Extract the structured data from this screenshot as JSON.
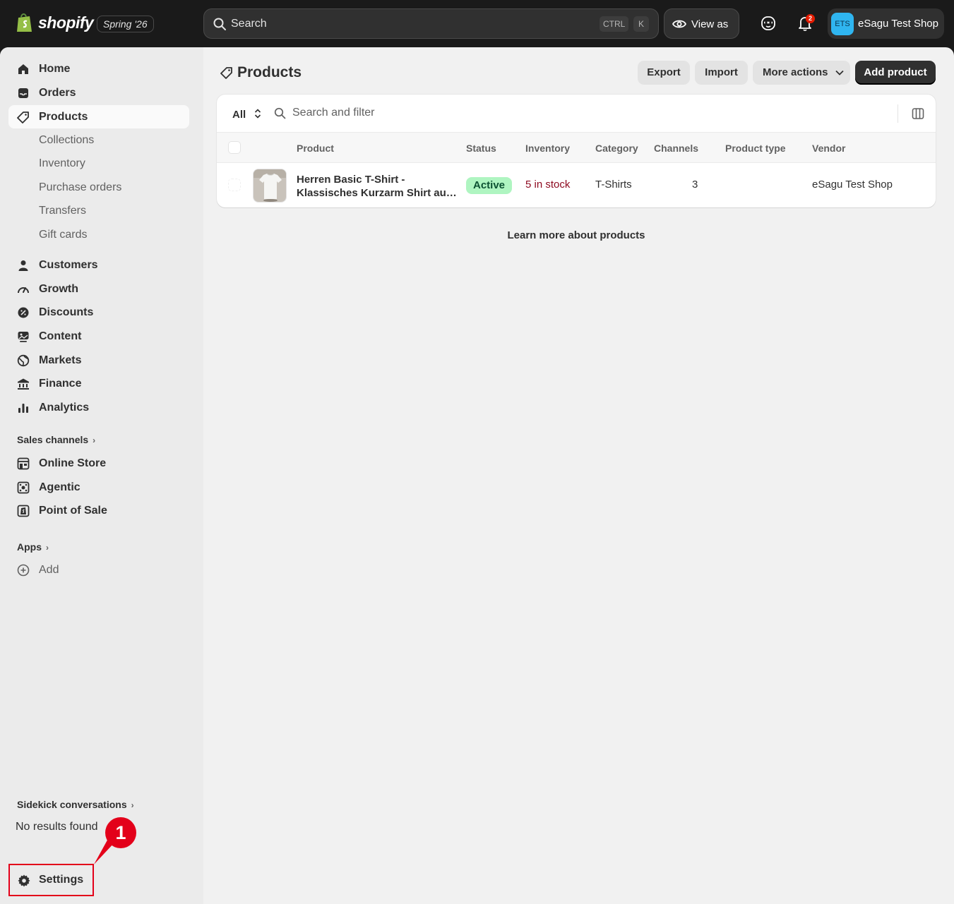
{
  "topbar": {
    "brand": "shopify",
    "edition": "Spring '26",
    "search_placeholder": "Search",
    "shortcut_ctrl": "CTRL",
    "shortcut_k": "K",
    "view_as": "View as",
    "notification_count": "2",
    "store_initials": "ETS",
    "store_name": "eSagu Test Shop"
  },
  "sidebar": {
    "main": [
      {
        "label": "Home",
        "icon": "home-icon"
      },
      {
        "label": "Orders",
        "icon": "inbox-icon"
      },
      {
        "label": "Products",
        "icon": "tag-icon"
      }
    ],
    "products_sub": [
      "Collections",
      "Inventory",
      "Purchase orders",
      "Transfers",
      "Gift cards"
    ],
    "more": [
      {
        "label": "Customers",
        "icon": "person-icon"
      },
      {
        "label": "Growth",
        "icon": "gauge-icon"
      },
      {
        "label": "Discounts",
        "icon": "discount-icon"
      },
      {
        "label": "Content",
        "icon": "content-icon"
      },
      {
        "label": "Markets",
        "icon": "globe-icon"
      },
      {
        "label": "Finance",
        "icon": "bank-icon"
      },
      {
        "label": "Analytics",
        "icon": "bar-chart-icon"
      }
    ],
    "sales_channels_heading": "Sales channels",
    "channels": [
      {
        "label": "Online Store",
        "icon": "store-icon"
      },
      {
        "label": "Agentic",
        "icon": "agentic-icon"
      },
      {
        "label": "Point of Sale",
        "icon": "pos-icon"
      }
    ],
    "apps_heading": "Apps",
    "add_label": "Add",
    "sidekick_heading": "Sidekick conversations",
    "sidekick_empty": "No results found",
    "settings_label": "Settings",
    "callout_number": "1"
  },
  "page": {
    "title": "Products",
    "actions": {
      "export": "Export",
      "import": "Import",
      "more_actions": "More actions",
      "add_product": "Add product"
    },
    "filter": {
      "view": "All",
      "search_placeholder": "Search and filter"
    },
    "columns": [
      "Product",
      "Status",
      "Inventory",
      "Category",
      "Channels",
      "Product type",
      "Vendor"
    ],
    "rows": [
      {
        "product_line1": "Herren Basic T-Shirt -",
        "product_line2": "Klassisches Kurzarm Shirt aus...",
        "status": "Active",
        "inventory": "5 in stock",
        "category": "T-Shirts",
        "channels": "3",
        "product_type": "",
        "vendor": "eSagu Test Shop"
      }
    ],
    "learn_more": "Learn more about products"
  },
  "colors": {
    "topbar": "#1a1a1a",
    "sidebar": "#ebebeb",
    "active_badge": "#aff5c1",
    "stock_text": "#8e0b21",
    "annotation_red": "#e3001a"
  }
}
